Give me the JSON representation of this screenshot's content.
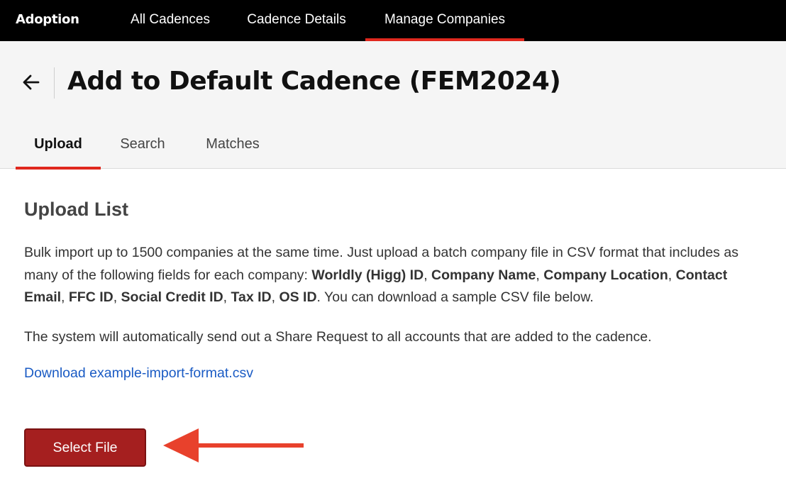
{
  "topnav": {
    "brand": "Adoption",
    "items": [
      {
        "label": "All Cadences"
      },
      {
        "label": "Cadence Details"
      },
      {
        "label": "Manage Companies"
      }
    ]
  },
  "header": {
    "title": "Add to Default Cadence (FEM2024)"
  },
  "tabs": [
    {
      "label": "Upload"
    },
    {
      "label": "Search"
    },
    {
      "label": "Matches"
    }
  ],
  "upload": {
    "section_title": "Upload List",
    "intro": "Bulk import up to 1500 companies at the same time. Just upload a batch company file in CSV format that includes as many of the following fields for each company: ",
    "fields": [
      "Worldly (Higg) ID",
      "Company Name",
      "Company Location",
      "Contact Email",
      "FFC ID",
      "Social Credit ID",
      "Tax ID",
      "OS ID"
    ],
    "outro": ". You can download a sample CSV file below.",
    "share_note": "The system will automatically send out a Share Request to all accounts that are added to the cadence.",
    "download_link": "Download example-import-format.csv",
    "select_file_label": "Select File"
  },
  "colors": {
    "accent": "#e0281e",
    "button": "#a51f1f",
    "link": "#1a5bc4",
    "arrow": "#e8412c"
  }
}
